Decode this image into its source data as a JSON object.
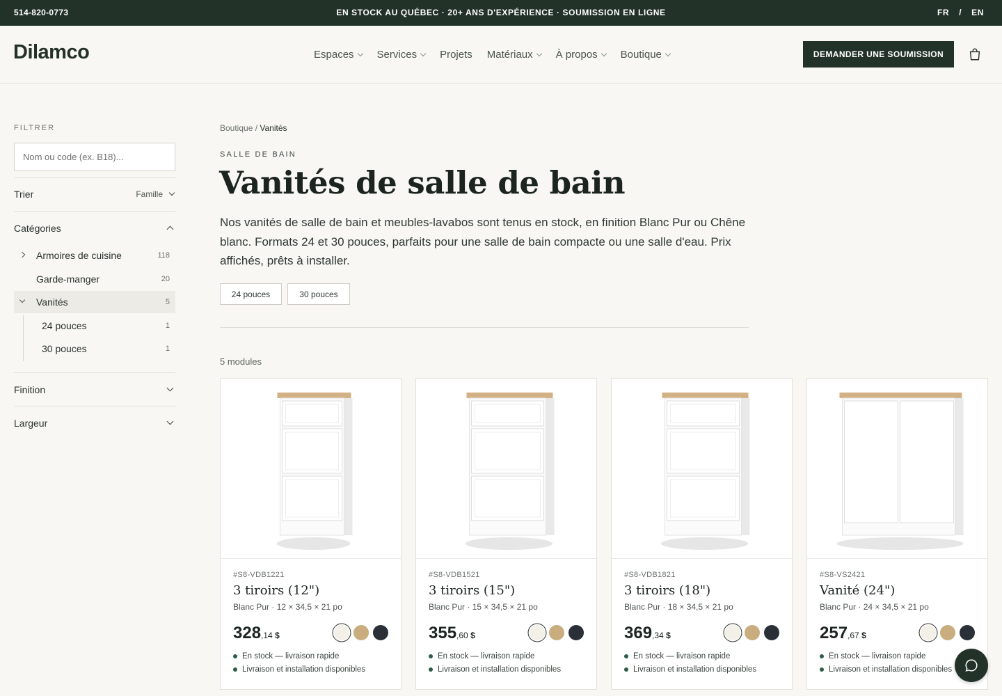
{
  "topbar": {
    "phone": "514-820-0773",
    "promo": "EN STOCK AU QUÉBEC · 20+ ANS D'EXPÉRIENCE · SOUMISSION EN LIGNE",
    "lang_fr": "FR",
    "lang_sep": "/",
    "lang_en": "EN"
  },
  "header": {
    "logo": "Dilamco",
    "nav": [
      "Espaces",
      "Services",
      "Projets",
      "Matériaux",
      "À propos",
      "Boutique"
    ],
    "cta": "DEMANDER UNE SOUMISSION"
  },
  "sidebar": {
    "filter_title": "FILTRER",
    "search_placeholder": "Nom ou code (ex. B18)...",
    "sort_label": "Trier",
    "sort_value": "Famille",
    "categories_title": "Catégories",
    "categories": [
      {
        "label": "Armoires de cuisine",
        "count": "118"
      },
      {
        "label": "Garde-manger",
        "count": "20"
      },
      {
        "label": "Vanités",
        "count": "5"
      }
    ],
    "subcategories": [
      {
        "label": "24 pouces",
        "count": "1"
      },
      {
        "label": "30 pouces",
        "count": "1"
      }
    ],
    "finish_title": "Finition",
    "width_title": "Largeur"
  },
  "main": {
    "breadcrumb_root": "Boutique",
    "breadcrumb_sep": " / ",
    "breadcrumb_current": "Vanités",
    "eyebrow": "SALLE DE BAIN",
    "title": "Vanités de salle de bain",
    "description": "Nos vanités de salle de bain et meubles-lavabos sont tenus en stock, en finition Blanc Pur ou Chêne blanc. Formats 24 et 30 pouces, parfaits pour une salle de bain compacte ou une salle d'eau. Prix affichés, prêts à installer.",
    "chips": [
      "24 pouces",
      "30 pouces"
    ],
    "count": "5 modules"
  },
  "swatch_colors": [
    "#f3f0e8",
    "#c9ad7f",
    "#2a2f38"
  ],
  "products": [
    {
      "code": "#S8-VDB1221",
      "name": "3 tiroirs (12\")",
      "spec": "Blanc Pur · 12 × 34,5 × 21 po",
      "price_int": "328",
      "price_dec": ",14",
      "currency": " $",
      "bullet1": "En stock — livraison rapide",
      "bullet2": "Livraison et installation disponibles",
      "image": "cabinet-3-drawers-narrow"
    },
    {
      "code": "#S8-VDB1521",
      "name": "3 tiroirs (15\")",
      "spec": "Blanc Pur · 15 × 34,5 × 21 po",
      "price_int": "355",
      "price_dec": ",60",
      "currency": " $",
      "bullet1": "En stock — livraison rapide",
      "bullet2": "Livraison et installation disponibles",
      "image": "cabinet-3-drawers"
    },
    {
      "code": "#S8-VDB1821",
      "name": "3 tiroirs (18\")",
      "spec": "Blanc Pur · 18 × 34,5 × 21 po",
      "price_int": "369",
      "price_dec": ",34",
      "currency": " $",
      "bullet1": "En stock — livraison rapide",
      "bullet2": "Livraison et installation disponibles",
      "image": "cabinet-3-drawers"
    },
    {
      "code": "#S8-VS2421",
      "name": "Vanité (24\")",
      "spec": "Blanc Pur · 24 × 34,5 × 21 po",
      "price_int": "257",
      "price_dec": ",67",
      "currency": " $",
      "bullet1": "En stock — livraison rapide",
      "bullet2": "Livraison et installation disponibles",
      "image": "cabinet-2-doors"
    }
  ],
  "icons": {
    "cart": "cart-icon",
    "chat": "chat-icon",
    "chevron": "chevron-down-icon"
  }
}
